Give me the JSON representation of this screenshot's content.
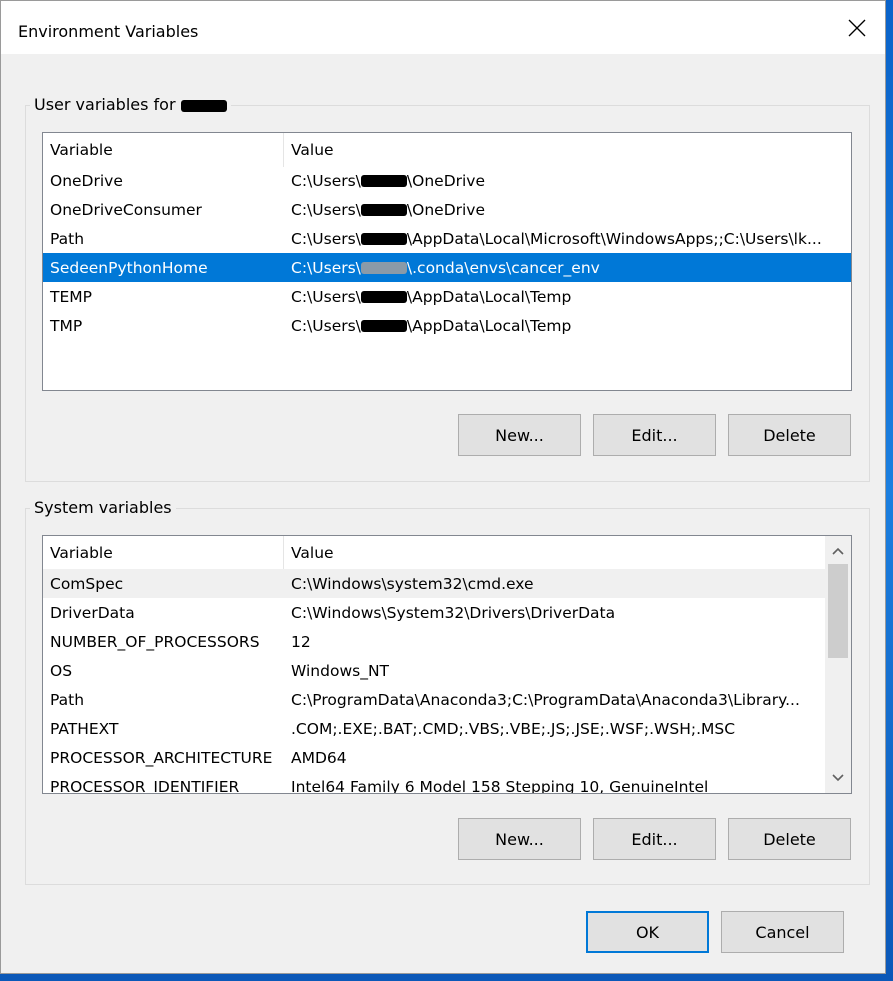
{
  "window": {
    "title": "Environment Variables"
  },
  "user_vars": {
    "group_label": "User variables for",
    "columns": [
      "Variable",
      "Value"
    ],
    "rows": [
      {
        "name": "OneDrive",
        "pre": "C:\\Users\\",
        "post": "\\OneDrive"
      },
      {
        "name": "OneDriveConsumer",
        "pre": "C:\\Users\\",
        "post": "\\OneDrive"
      },
      {
        "name": "Path",
        "pre": "C:\\Users\\",
        "post": "\\AppData\\Local\\Microsoft\\WindowsApps;;C:\\Users\\lk..."
      },
      {
        "name": "SedeenPythonHome",
        "pre": "C:\\Users\\",
        "post": "\\.conda\\envs\\cancer_env"
      },
      {
        "name": "TEMP",
        "pre": "C:\\Users\\",
        "post": "\\AppData\\Local\\Temp"
      },
      {
        "name": "TMP",
        "pre": "C:\\Users\\",
        "post": "\\AppData\\Local\\Temp"
      }
    ],
    "selected_index": 3,
    "buttons": {
      "new": "New...",
      "edit": "Edit...",
      "delete": "Delete"
    }
  },
  "system_vars": {
    "group_label": "System variables",
    "columns": [
      "Variable",
      "Value"
    ],
    "rows": [
      {
        "name": "ComSpec",
        "value": "C:\\Windows\\system32\\cmd.exe"
      },
      {
        "name": "DriverData",
        "value": "C:\\Windows\\System32\\Drivers\\DriverData"
      },
      {
        "name": "NUMBER_OF_PROCESSORS",
        "value": "12"
      },
      {
        "name": "OS",
        "value": "Windows_NT"
      },
      {
        "name": "Path",
        "value": "C:\\ProgramData\\Anaconda3;C:\\ProgramData\\Anaconda3\\Library..."
      },
      {
        "name": "PATHEXT",
        "value": ".COM;.EXE;.BAT;.CMD;.VBS;.VBE;.JS;.JSE;.WSF;.WSH;.MSC"
      },
      {
        "name": "PROCESSOR_ARCHITECTURE",
        "value": "AMD64"
      },
      {
        "name": "PROCESSOR_IDENTIFIER",
        "value": "Intel64 Family 6 Model 158 Stepping 10, GenuineIntel"
      }
    ],
    "buttons": {
      "new": "New...",
      "edit": "Edit...",
      "delete": "Delete"
    }
  },
  "footer": {
    "ok": "OK",
    "cancel": "Cancel"
  },
  "colors": {
    "selection": "#0078d7",
    "dialog_bg": "#f0f0f0",
    "button_bg": "#e1e1e1",
    "default_button_border": "#0078d7"
  },
  "icons": {
    "close": "close-icon",
    "scroll_up": "chevron-up-icon",
    "scroll_down": "chevron-down-icon"
  }
}
